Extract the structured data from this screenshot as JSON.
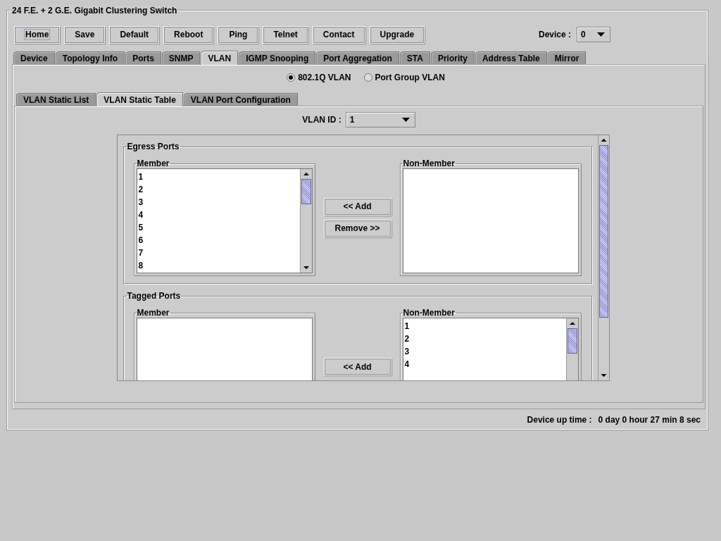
{
  "window": {
    "title": "24 F.E. + 2 G.E. Gigabit Clustering Switch"
  },
  "toolbar": {
    "buttons": [
      {
        "label": "Home",
        "focused": true
      },
      {
        "label": "Save",
        "focused": false
      },
      {
        "label": "Default",
        "focused": false
      },
      {
        "label": "Reboot",
        "focused": false
      },
      {
        "label": "Ping",
        "focused": false
      },
      {
        "label": "Telnet",
        "focused": false
      },
      {
        "label": "Contact",
        "focused": false
      },
      {
        "label": "Upgrade",
        "focused": false
      }
    ],
    "device": {
      "label": "Device :",
      "value": "0"
    }
  },
  "tabs": [
    {
      "label": "Device",
      "selected": false
    },
    {
      "label": "Topology Info",
      "selected": false
    },
    {
      "label": "Ports",
      "selected": false
    },
    {
      "label": "SNMP",
      "selected": false
    },
    {
      "label": "VLAN",
      "selected": true
    },
    {
      "label": "IGMP Snooping",
      "selected": false
    },
    {
      "label": "Port Aggregation",
      "selected": false
    },
    {
      "label": "STA",
      "selected": false
    },
    {
      "label": "Priority",
      "selected": false
    },
    {
      "label": "Address Table",
      "selected": false
    },
    {
      "label": "Mirror",
      "selected": false
    }
  ],
  "vlan_mode": [
    {
      "label": "802.1Q VLAN",
      "selected": true
    },
    {
      "label": "Port Group VLAN",
      "selected": false
    }
  ],
  "sub_tabs": [
    {
      "label": "VLAN Static List",
      "selected": false
    },
    {
      "label": "VLAN Static Table",
      "selected": true
    },
    {
      "label": "VLAN Port Configuration",
      "selected": false
    }
  ],
  "vlan_id": {
    "label": "VLAN ID :",
    "value": "1"
  },
  "groups": [
    {
      "title": "Egress Ports",
      "member": {
        "title": "Member",
        "items": [
          "1",
          "2",
          "3",
          "4",
          "5",
          "6",
          "7",
          "8"
        ]
      },
      "non_member": {
        "title": "Non-Member"
      },
      "buttons": [
        "<< Add",
        "Remove >>"
      ]
    },
    {
      "title": "Tagged Ports",
      "member": {
        "title": "Member"
      },
      "non_member": {
        "title": "Non-Member",
        "items": [
          "1",
          "2",
          "3",
          "4"
        ]
      },
      "buttons": [
        "<< Add"
      ]
    }
  ],
  "status_bar": {
    "label": "Device up time :",
    "value": "0 day 0 hour 27 min 8 sec"
  }
}
